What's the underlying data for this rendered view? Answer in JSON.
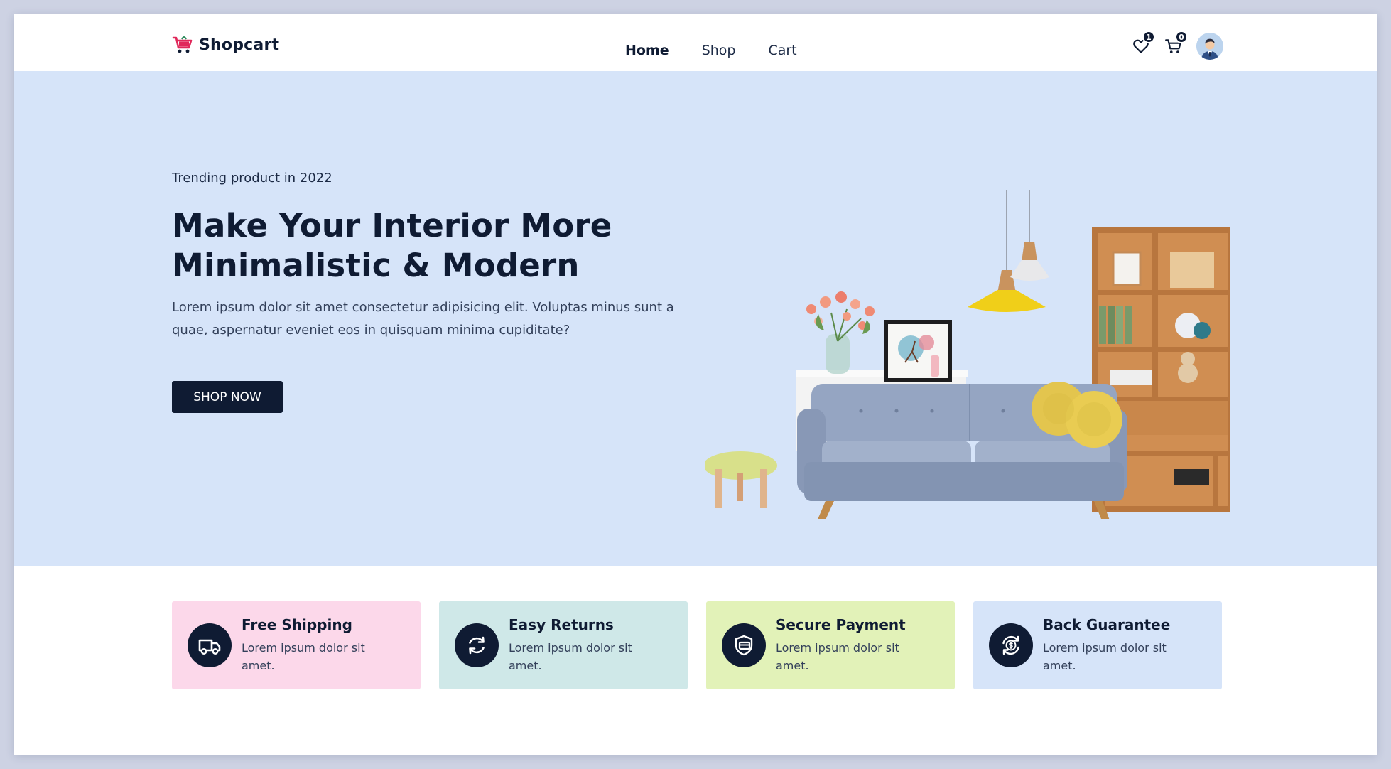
{
  "header": {
    "brand": "Shopcart",
    "brand_icon": "shopping-cart-icon",
    "nav": [
      {
        "label": "Home",
        "active": true
      },
      {
        "label": "Shop",
        "active": false
      },
      {
        "label": "Cart",
        "active": false
      }
    ],
    "wishlist_count": "1",
    "cart_count": "0",
    "wishlist_icon": "heart-icon",
    "cart_icon": "cart-icon",
    "avatar_icon": "user-avatar-icon"
  },
  "hero": {
    "eyebrow": "Trending product in 2022",
    "title_line1": "Make Your Interior More",
    "title_line2": "Minimalistic & Modern",
    "description": "Lorem ipsum dolor sit amet consectetur adipisicing elit. Voluptas minus sunt a quae, aspernatur eveniet eos in quisquam minima cupiditate?",
    "cta_label": "SHOP NOW",
    "image": "living-room-furniture-illustration"
  },
  "features": [
    {
      "title": "Free Shipping",
      "text": "Lorem ipsum dolor sit amet.",
      "icon": "truck-icon",
      "bg": "#fcd8ea"
    },
    {
      "title": "Easy Returns",
      "text": "Lorem ipsum dolor sit amet.",
      "icon": "refresh-icon",
      "bg": "#cfe8e8"
    },
    {
      "title": "Secure Payment",
      "text": "Lorem ipsum dolor sit amet.",
      "icon": "secure-card-icon",
      "bg": "#e2f2b8"
    },
    {
      "title": "Back Guarantee",
      "text": "Lorem ipsum dolor sit amet.",
      "icon": "money-back-icon",
      "bg": "#d6e4f9"
    }
  ],
  "colors": {
    "primary": "#0f1b33",
    "hero_bg": "#d6e4f9",
    "page_bg": "#cdd2e3"
  }
}
